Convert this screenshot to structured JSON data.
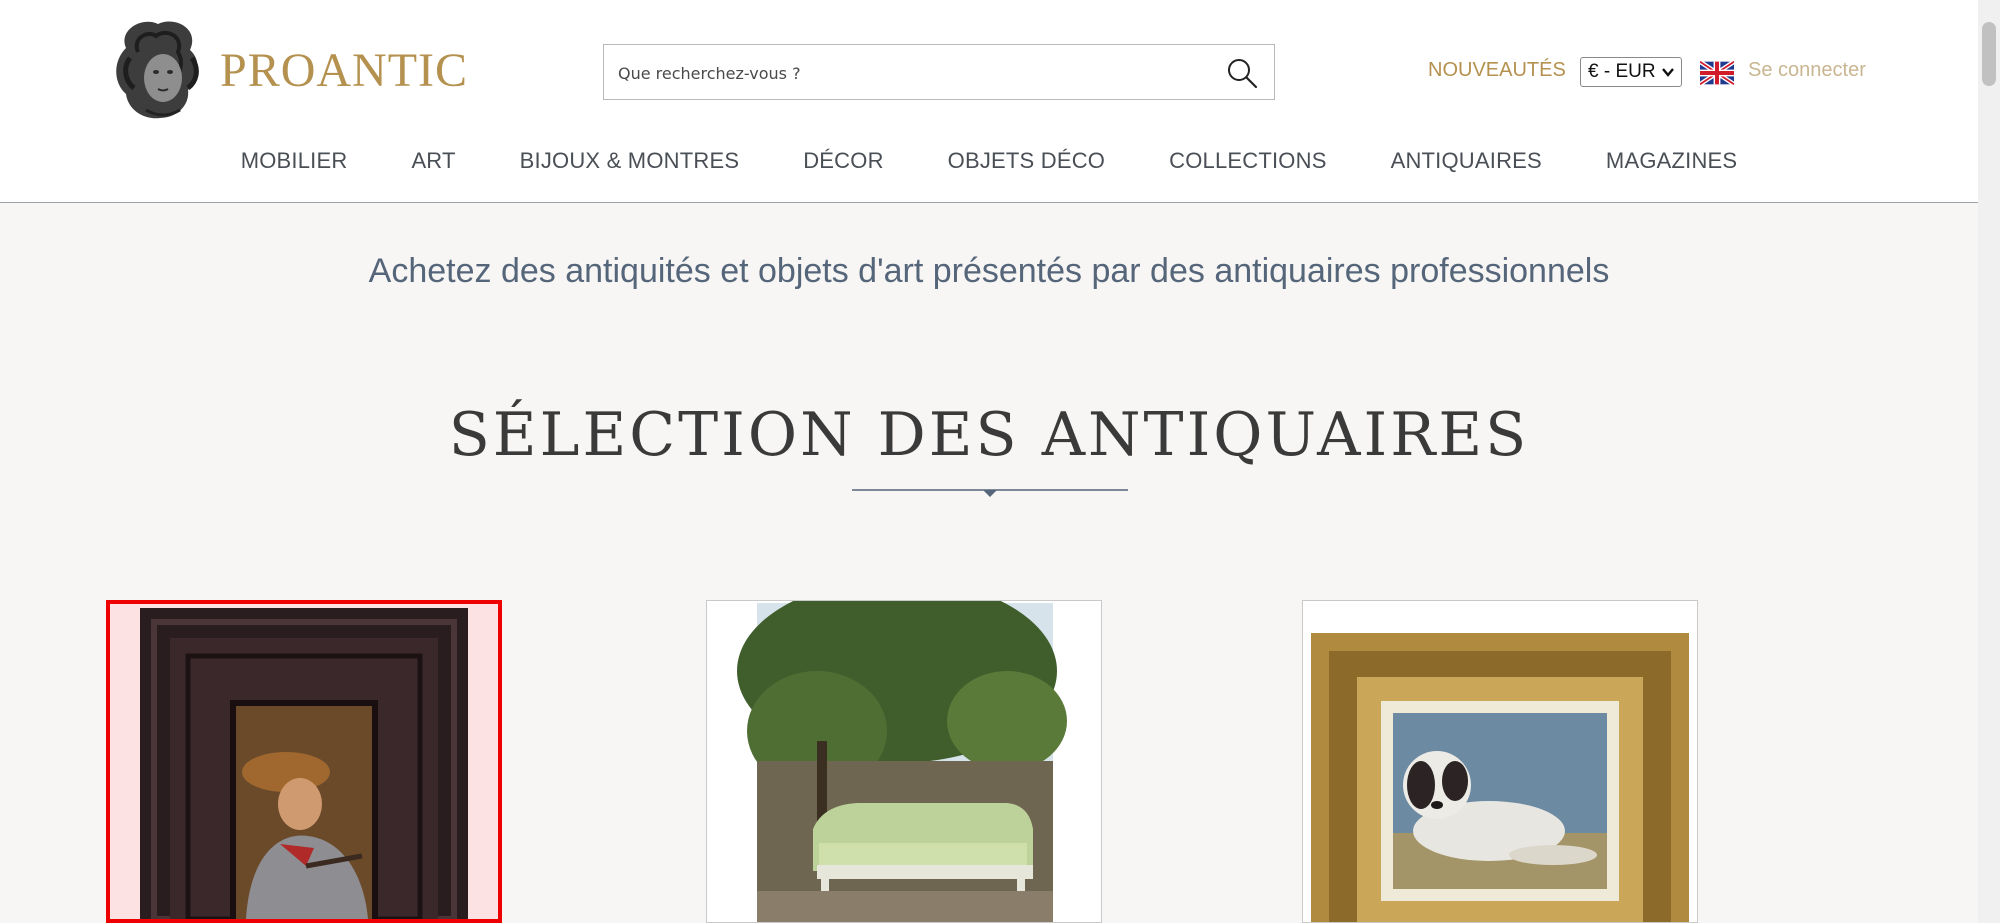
{
  "brand": {
    "name": "PROANTIC"
  },
  "search": {
    "placeholder": "Que recherchez-vous ?"
  },
  "header": {
    "new_label": "NOUVEAUTÉS",
    "currency_value": "€ - EUR",
    "login_label": "Se connecter"
  },
  "nav": {
    "items": [
      {
        "label": "MOBILIER"
      },
      {
        "label": "ART"
      },
      {
        "label": "BIJOUX & MONTRES"
      },
      {
        "label": "DÉCOR"
      },
      {
        "label": "OBJETS DÉCO"
      },
      {
        "label": "COLLECTIONS"
      },
      {
        "label": "ANTIQUAIRES"
      },
      {
        "label": "MAGAZINES"
      }
    ]
  },
  "main": {
    "tagline": "Achetez des antiquités et objets d'art présentés par des antiquaires professionnels",
    "section_title": "SÉLECTION DES ANTIQUAIRES"
  },
  "colors": {
    "gold": "#b5914f",
    "nav_text": "#4a4f56",
    "tagline": "#55657a",
    "background": "#f7f6f4",
    "selection": "#ee0000"
  },
  "icons": {
    "search": "magnifier-icon",
    "flag": "uk-flag-icon",
    "chevron": "chevron-down-icon"
  }
}
